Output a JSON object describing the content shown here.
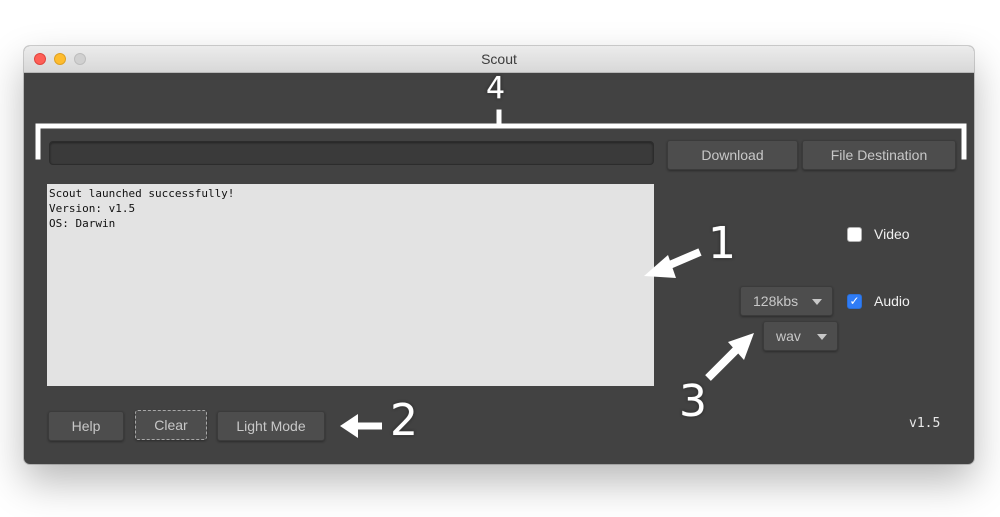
{
  "window": {
    "title": "Scout"
  },
  "toolbar": {
    "url_value": "",
    "download_label": "Download",
    "file_destination_label": "File Destination"
  },
  "console": {
    "lines": [
      "Scout launched successfully!",
      "Version: v1.5",
      "OS: Darwin"
    ]
  },
  "options": {
    "video": {
      "label": "Video",
      "checked": false
    },
    "audio": {
      "label": "Audio",
      "checked": true
    },
    "bitrate": "128kbs",
    "format": "wav"
  },
  "footer": {
    "help_label": "Help",
    "clear_label": "Clear",
    "light_mode_label": "Light Mode",
    "version": "v1.5"
  },
  "annotations": [
    "4",
    "1",
    "2",
    "3"
  ],
  "colors": {
    "window_bg": "#424242",
    "console_bg": "#e3e3e3",
    "checkbox_checked": "#2f7cf6",
    "annotation": "#ffffff"
  },
  "icons": {
    "close": "close-icon",
    "minimize": "minimize-icon",
    "maximize": "maximize-icon",
    "dropdown": "chevron-down-icon",
    "checkmark": "checkmark-icon"
  }
}
